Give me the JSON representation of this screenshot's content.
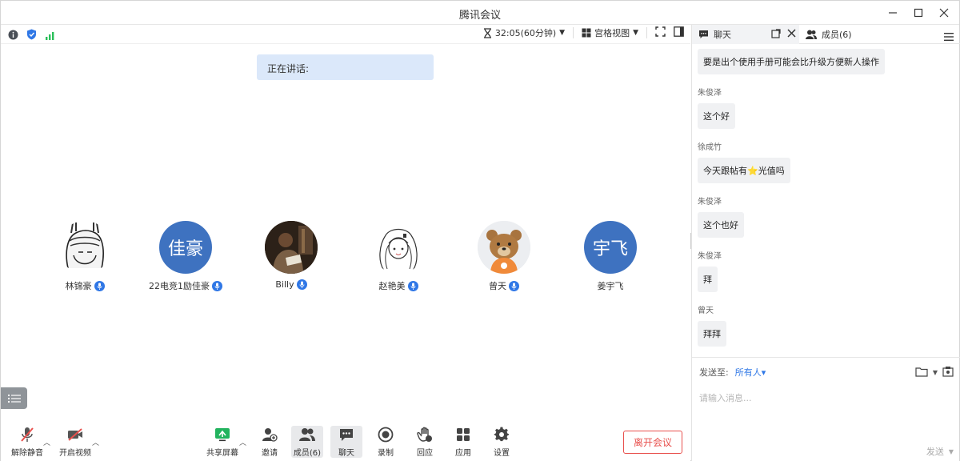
{
  "window": {
    "title": "腾讯会议"
  },
  "topbar": {
    "timer": "32:05(60分钟)",
    "view_label": "宫格视图"
  },
  "stage": {
    "speaking_label": "正在讲话:",
    "participants": [
      {
        "name": "林锦豪",
        "avatar_text": "",
        "avatar_kind": "drawing"
      },
      {
        "name": "22电竞1励佳豪",
        "avatar_text": "佳豪",
        "avatar_kind": "text"
      },
      {
        "name": "Billy",
        "avatar_text": "",
        "avatar_kind": "photo"
      },
      {
        "name": "赵艳美",
        "avatar_text": "",
        "avatar_kind": "drawing"
      },
      {
        "name": "曾天",
        "avatar_text": "",
        "avatar_kind": "bear"
      },
      {
        "name": "姜宇飞",
        "avatar_text": "宇飞",
        "avatar_kind": "text"
      }
    ]
  },
  "toolbar": {
    "unmute": "解除静音",
    "video": "开启视频",
    "share": "共享屏幕",
    "invite": "邀请",
    "members": "成员(6)",
    "chat": "聊天",
    "record": "录制",
    "react": "回应",
    "apps": "应用",
    "settings": "设置",
    "leave": "离开会议"
  },
  "panel": {
    "tab_chat": "聊天",
    "tab_members": "成员(6)",
    "messages": [
      {
        "sender": "",
        "text": "要是出个使用手册可能会比升级方便新人操作"
      },
      {
        "sender": "朱俊泽",
        "text": "这个好"
      },
      {
        "sender": "徐成竹",
        "text": "今天跟帖有⭐光值吗"
      },
      {
        "sender": "朱俊泽",
        "text": "这个也好"
      },
      {
        "sender": "朱俊泽",
        "text": "拜"
      },
      {
        "sender": "曾天",
        "text": "拜拜"
      }
    ],
    "send_to_label": "发送至:",
    "send_to_value": "所有人▾",
    "input_placeholder": "请输入消息...",
    "send_label": "发送"
  },
  "colors": {
    "accent": "#2f77e6",
    "danger": "#e8504d",
    "avatar_blue": "#3e72c0"
  }
}
